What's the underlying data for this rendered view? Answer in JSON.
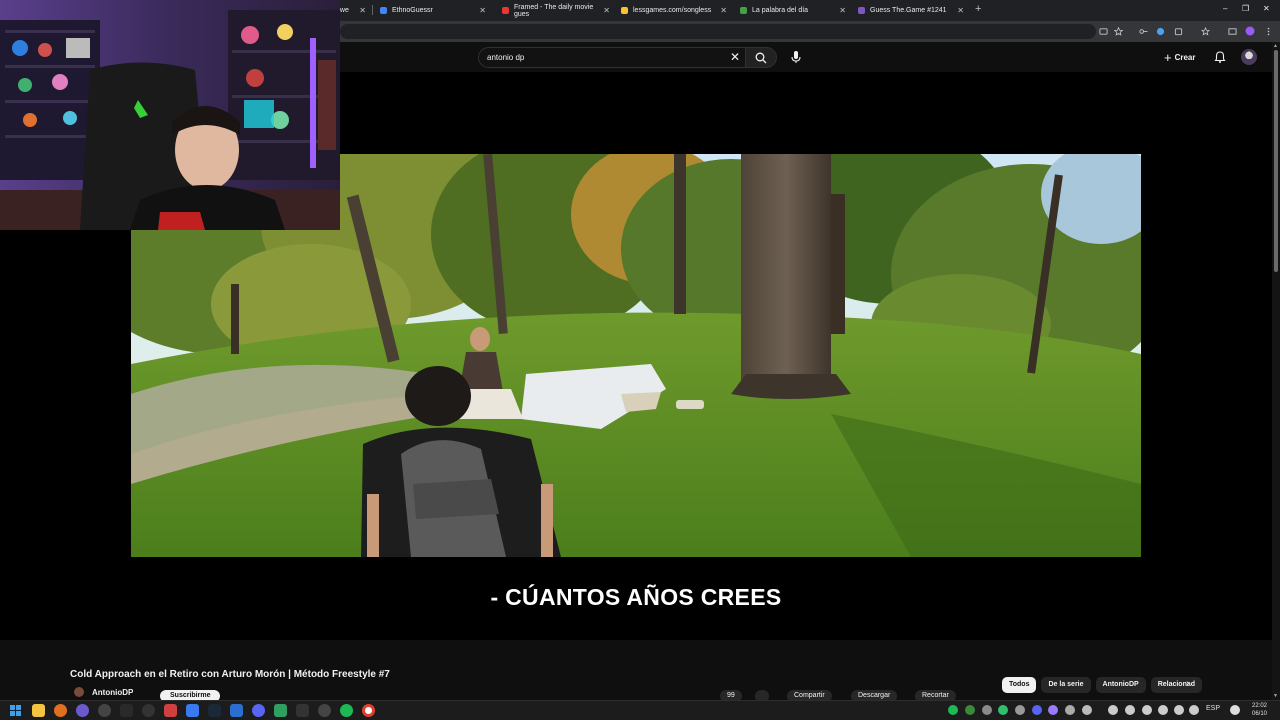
{
  "browser": {
    "tabs": [
      {
        "title": "owe",
        "favicon_color": "#3a3a3a"
      },
      {
        "title": "EthnoGuessr",
        "favicon_color": "#4285f4"
      },
      {
        "title": "Framed - The daily movie gues",
        "favicon_color": "#e53935"
      },
      {
        "title": "lessgames.com/songless",
        "favicon_color": "#fbc02d"
      },
      {
        "title": "La palabra del día",
        "favicon_color": "#43a047"
      },
      {
        "title": "Guess The.Game #1241",
        "favicon_color": "#7e57c2"
      }
    ],
    "new_tab": "+",
    "close_glyph": "✕",
    "window_controls": {
      "minimize": "–",
      "maximize": "❐",
      "close": "✕"
    }
  },
  "header": {
    "search_value": "antonio dp",
    "clear_glyph": "✕",
    "create_label": "Crear",
    "create_glyph": "+"
  },
  "player": {
    "subtitle": "- CÚANTOS AÑOS CREES"
  },
  "video": {
    "title": "Cold Approach en el Retiro con Arturo Morón | Método Freestyle #7",
    "channel": "AntonioDP",
    "subscribe_label": "Suscribirme",
    "actions": [
      {
        "label": "99"
      },
      {
        "label": ""
      },
      {
        "label": "Compartir"
      },
      {
        "label": "Descargar"
      },
      {
        "label": "Recortar"
      }
    ]
  },
  "chips": [
    {
      "label": "Todos",
      "active": true
    },
    {
      "label": "De la serie",
      "active": false
    },
    {
      "label": "AntonioDP",
      "active": false
    },
    {
      "label": "Relacionad",
      "active": false
    }
  ],
  "chips_next_glyph": "›",
  "taskbar": {
    "tray_lang": "ESP",
    "time": "22:02",
    "date": "06/10"
  },
  "colors": {
    "yt_bg": "#0f0f0f",
    "accent_purple": "#9b59f5",
    "browser_frame": "#202124"
  }
}
